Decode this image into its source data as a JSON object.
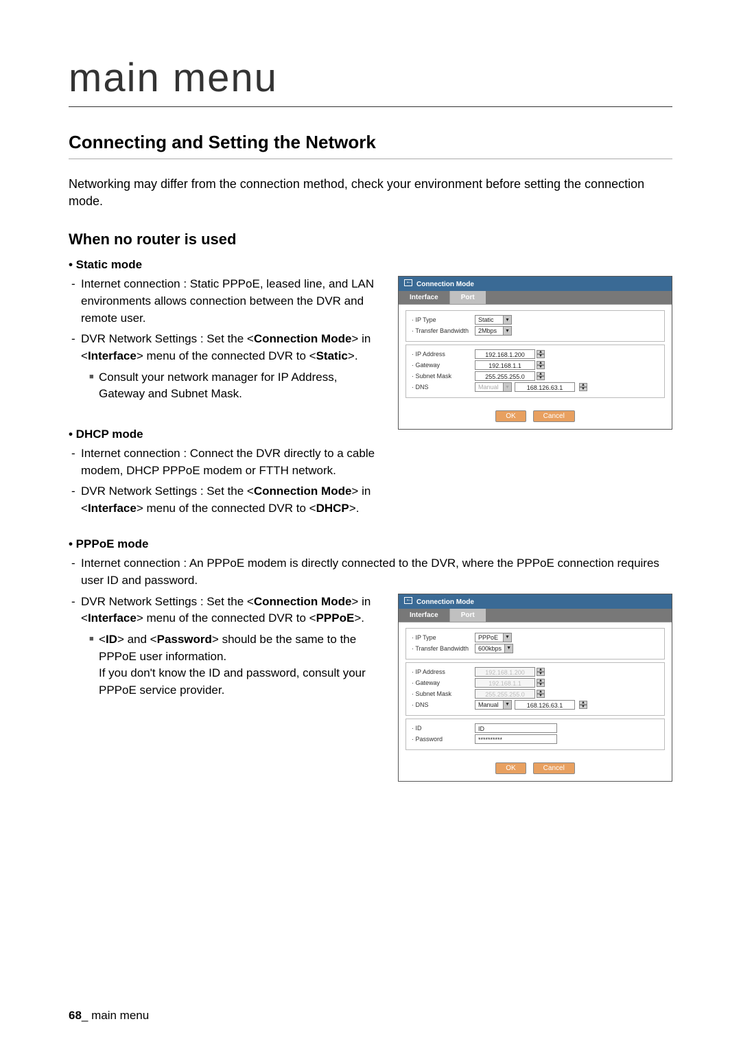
{
  "page_title": "main menu",
  "section_title": "Connecting and Setting the Network",
  "intro": "Networking may differ from the connection method, check your environment before setting the connection mode.",
  "sub_heading": "When no router is used",
  "static": {
    "title": "• Static mode",
    "item1_a": "Internet connection : Static PPPoE, leased line, and LAN environments allows connection between the DVR and remote user.",
    "item2_pre": "DVR Network Settings : Set the <",
    "item2_bold1": "Connection Mode",
    "item2_mid": "> in <",
    "item2_bold2": "Interface",
    "item2_mid2": "> menu of the connected DVR to <",
    "item2_bold3": "Static",
    "item2_end": ">.",
    "sub1": "Consult your network manager for IP Address, Gateway and Subnet Mask."
  },
  "dhcp": {
    "title": "• DHCP mode",
    "item1": "Internet connection : Connect the DVR directly to a cable modem, DHCP PPPoE modem or FTTH network.",
    "item2_pre": "DVR Network Settings : Set the <",
    "item2_bold1": "Connection Mode",
    "item2_mid": "> in <",
    "item2_bold2": "Interface",
    "item2_mid2": "> menu of the connected DVR to <",
    "item2_bold3": "DHCP",
    "item2_end": ">."
  },
  "pppoe": {
    "title": "• PPPoE mode",
    "item1": "Internet connection : An PPPoE modem is directly connected to the DVR, where the PPPoE connection requires user ID and password.",
    "item2_pre": "DVR Network Settings : Set the <",
    "item2_bold1": "Connection Mode",
    "item2_mid": "> in <",
    "item2_bold2": "Interface",
    "item2_mid2": "> menu of the connected DVR to <",
    "item2_bold3": "PPPoE",
    "item2_end": ">.",
    "sub1_pre": "<",
    "sub1_b1": "ID",
    "sub1_mid": "> and <",
    "sub1_b2": "Password",
    "sub1_end": "> should be the same to the PPPoE user information.",
    "sub1_line2": "If you don't know the ID and password, consult your PPPoE service provider."
  },
  "dialog1": {
    "title": "Connection Mode",
    "tab1": "Interface",
    "tab2": "Port",
    "labels": {
      "ip_type": "· IP Type",
      "bandwidth": "· Transfer Bandwidth",
      "ip_addr": "· IP Address",
      "gateway": "· Gateway",
      "subnet": "· Subnet Mask",
      "dns": "· DNS"
    },
    "values": {
      "ip_type": "Static",
      "bandwidth": "2Mbps",
      "ip_addr": "192.168.1.200",
      "gateway": "192.168.1.1",
      "subnet": "255.255.255.0",
      "dns_mode": "Manual",
      "dns_ip": "168.126.63.1"
    },
    "ok": "OK",
    "cancel": "Cancel"
  },
  "dialog2": {
    "title": "Connection Mode",
    "tab1": "Interface",
    "tab2": "Port",
    "labels": {
      "ip_type": "· IP Type",
      "bandwidth": "· Transfer Bandwidth",
      "ip_addr": "· IP Address",
      "gateway": "· Gateway",
      "subnet": "· Subnet Mask",
      "dns": "· DNS",
      "id": "· ID",
      "password": "· Password"
    },
    "values": {
      "ip_type": "PPPoE",
      "bandwidth": "600kbps",
      "ip_addr": "192.168.1.200",
      "gateway": "192.168.1.1",
      "subnet": "255.255.255.0",
      "dns_mode": "Manual",
      "dns_ip": "168.126.63.1",
      "id": "ID",
      "password": "**********"
    },
    "ok": "OK",
    "cancel": "Cancel"
  },
  "footer": {
    "page_num": "68",
    "sep": "_ ",
    "label": "main menu"
  }
}
